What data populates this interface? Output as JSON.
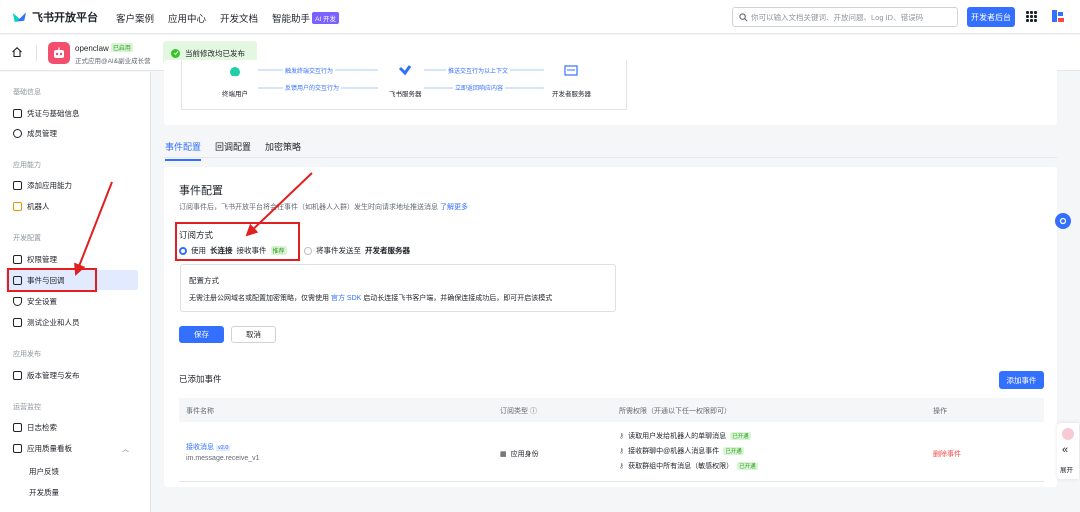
{
  "topnav": {
    "brand": "飞书开放平台",
    "links": [
      "客户案例",
      "应用中心",
      "开发文档",
      "智能助手"
    ],
    "ai_badge": "AI 开发",
    "search_placeholder": "你可以输入文档关键词、开放问题、Log ID、错误码",
    "console_button": "开发者后台"
  },
  "subheader": {
    "app_name": "openclaw",
    "app_status": "已启用",
    "app_subtitle": "正式应用@AI&副业成长营",
    "toast": "当前修改均已发布"
  },
  "sidebar": {
    "groups": [
      {
        "title": "基础信息",
        "items": [
          "凭证与基础信息",
          "成员管理"
        ]
      },
      {
        "title": "应用能力",
        "items": [
          "添加应用能力",
          "机器人"
        ]
      },
      {
        "title": "开发配置",
        "items": [
          "权限管理",
          "事件与回调",
          "安全设置",
          "测试企业和人员"
        ]
      },
      {
        "title": "应用发布",
        "items": [
          "版本管理与发布"
        ]
      },
      {
        "title": "运营监控",
        "items": [
          "日志检索",
          "应用质量看板"
        ]
      }
    ],
    "sub_items": [
      "用户反馈",
      "开发质量"
    ]
  },
  "diagram": {
    "labels": [
      "终端用户",
      "飞书服务器",
      "开发者服务器"
    ],
    "arrows": [
      "触发终端交互行为",
      "推送交互行为以上下文",
      "反馈用户的交互行为",
      "立即返回响应内容"
    ]
  },
  "tabs": [
    "事件配置",
    "回调配置",
    "加密策略"
  ],
  "config": {
    "title": "事件配置",
    "desc": "订阅事件后，飞书开放平台将会在事件（如机器人入群）发生时向请求地址推送消息",
    "learn_more": "了解更多",
    "mode_label": "订阅方式",
    "option1_pre": "使用",
    "option1_bold": "长连接",
    "option1_post": "接收事件",
    "recommended": "推荐",
    "option2_pre": "将事件发送至",
    "option2_bold": "开发者服务器",
    "info_title": "配置方式",
    "info_desc_1": "无需注册公网域名或配置加密策略，仅需使用",
    "info_desc_link": "官方 SDK",
    "info_desc_2": "启动长连接飞书客户端，并确保连接成功后，即可开启该模式",
    "save": "保存",
    "cancel": "取消"
  },
  "events": {
    "label": "已添加事件",
    "add_button": "添加事件",
    "headers": [
      "事件名称",
      "订阅类型",
      "所需权限（开通以下任一权限即可）",
      "操作"
    ],
    "rows": [
      {
        "name": "接收消息",
        "version": "v2.0",
        "code": "im.message.receive_v1",
        "type": "应用身份",
        "permissions": [
          {
            "text": "读取用户发给机器人的单聊消息",
            "status": "已开通"
          },
          {
            "text": "接收群聊中@机器人消息事件",
            "status": "已开通"
          },
          {
            "text": "获取群组中所有消息（敏感权限）",
            "status": "已开通"
          }
        ],
        "action": "删除事件"
      }
    ]
  },
  "float": {
    "collapse": "展开"
  },
  "colors": {
    "primary": "#3370ff",
    "annotation_red": "#e02020",
    "success_green": "#2ea121",
    "danger": "#f54a45"
  }
}
